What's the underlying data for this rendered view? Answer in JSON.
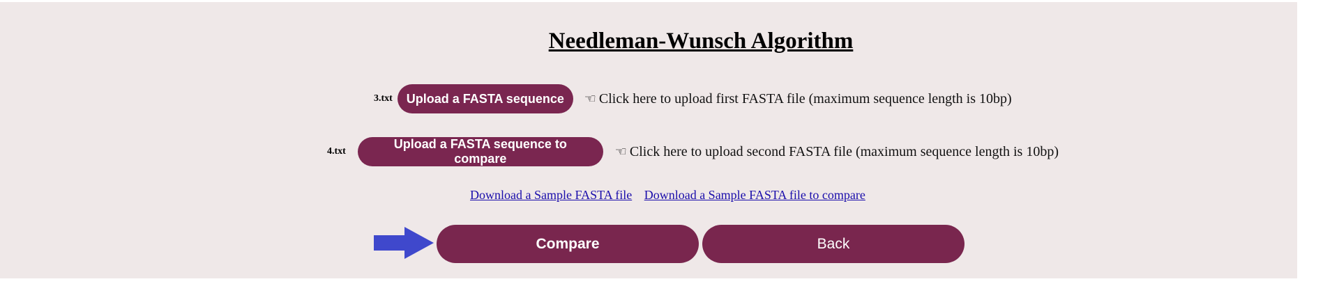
{
  "title": "Needleman-Wunsch Algorithm",
  "upload_first": {
    "file_name": "3.txt",
    "button_label": "Upload a FASTA sequence",
    "hint_icon": "pointing-hand-icon",
    "hint_text": "Click here to upload first FASTA file (maximum sequence length is 10bp)"
  },
  "upload_second": {
    "file_name": "4.txt",
    "button_label": "Upload a FASTA sequence to compare",
    "hint_icon": "pointing-hand-icon",
    "hint_text": "Click here to upload second FASTA file (maximum sequence length is 10bp)"
  },
  "links": {
    "sample_first": "Download a Sample FASTA file",
    "sample_second": "Download a Sample FASTA file to compare"
  },
  "actions": {
    "arrow_icon": "right-arrow-icon",
    "compare_label": "Compare",
    "back_label": "Back"
  },
  "colors": {
    "panel_bg": "#efe8e8",
    "button_bg": "#7a2650",
    "arrow": "#3f48cc",
    "link": "#1a0dab"
  }
}
